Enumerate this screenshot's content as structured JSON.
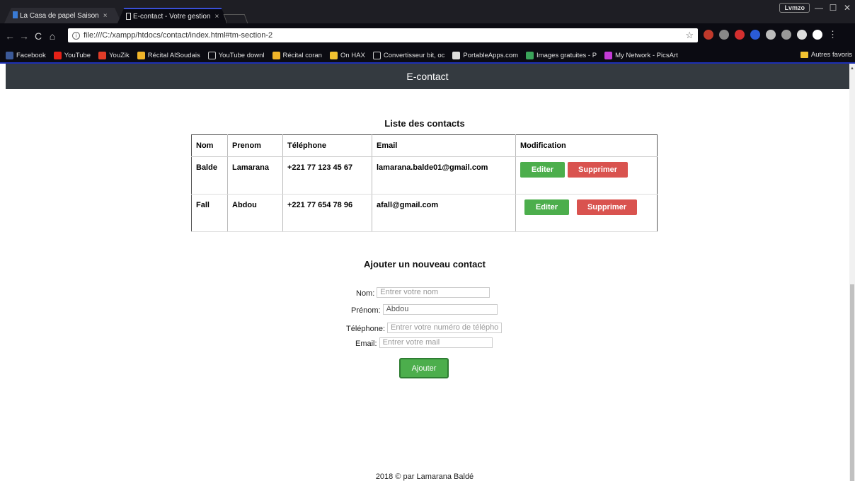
{
  "browser": {
    "tabs": [
      {
        "title": "La Casa de papel Saison",
        "close": "×"
      },
      {
        "title": "E-contact - Votre gestion",
        "close": "×"
      }
    ],
    "user_badge": "Lvmzo",
    "window_buttons": {
      "minimize": "—",
      "maximize": "☐",
      "close": "✕"
    },
    "nav": {
      "back": "←",
      "forward": "→",
      "reload": "C",
      "home": "⌂"
    },
    "url": "file:///C:/xampp/htdocs/contact/index.html#tm-section-2",
    "info_icon": "i",
    "star_icon": "☆",
    "bookmarks": [
      {
        "label": "Facebook",
        "color": "#3b5998"
      },
      {
        "label": "YouTube",
        "color": "#e62117"
      },
      {
        "label": "YouZik",
        "color": "#e03c28"
      },
      {
        "label": "Récital AlSoudais",
        "color": "#f0b429"
      },
      {
        "label": "YouTube downl",
        "color": "#0b0b12"
      },
      {
        "label": "Récital coran",
        "color": "#f0b429"
      },
      {
        "label": "On HAX",
        "color": "#f2c230"
      },
      {
        "label": "Convertisseur bit, oc",
        "color": "#0b0b12"
      },
      {
        "label": "PortableApps.com",
        "color": "#dddddd"
      },
      {
        "label": "Images gratuites - P",
        "color": "#3aa35a"
      },
      {
        "label": "My Network - PicsArt",
        "color": "#c33bd6"
      }
    ],
    "other_bookmarks": "Autres favoris",
    "menu_icon": "⋮"
  },
  "header": {
    "title": "E-contact"
  },
  "contacts": {
    "title": "Liste des contacts",
    "columns": [
      "Nom",
      "Prenom",
      "Téléphone",
      "Email",
      "Modification"
    ],
    "rows": [
      {
        "nom": "Balde",
        "prenom": "Lamarana",
        "telephone": "+221 77 123 45 67",
        "email": "lamarana.balde01@gmail.com"
      },
      {
        "nom": "Fall",
        "prenom": "Abdou",
        "telephone": "+221 77 654 78 96",
        "email": "afall@gmail.com"
      }
    ],
    "edit_label": "Editer",
    "delete_label": "Supprimer"
  },
  "form": {
    "title": "Ajouter un nouveau contact",
    "nom_label": "Nom:",
    "nom_placeholder": "Entrer votre nom",
    "prenom_label": "Prénom:",
    "prenom_value": "Abdou",
    "tel_label": "Téléphone:",
    "tel_placeholder": "Entrer votre numéro de téléphone",
    "email_label": "Email:",
    "email_placeholder": "Entrer votre mail",
    "submit_label": "Ajouter"
  },
  "footer": {
    "text": "2018 © par Lamarana Baldé"
  },
  "colors": {
    "header_bg": "#343a40",
    "edit": "#4cae4c",
    "delete": "#d9534f",
    "tab_accent": "#1d2fb3"
  }
}
